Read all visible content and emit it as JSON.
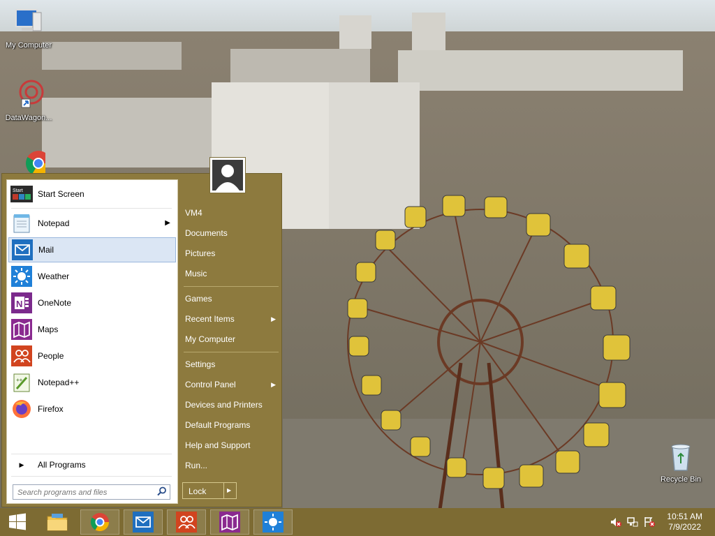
{
  "desktop": {
    "icons": [
      {
        "label": "My Computer",
        "icon": "computer-icon"
      },
      {
        "label": "DataWagon...",
        "icon": "datawagon-shortcut-icon"
      },
      {
        "label": "",
        "icon": "chrome-icon"
      },
      {
        "label": "Recycle Bin",
        "icon": "recycle-bin-icon"
      }
    ]
  },
  "start_menu": {
    "programs": [
      {
        "label": "Start Screen",
        "icon": "start-screen-icon",
        "has_submenu": false,
        "selected": false
      },
      {
        "label": "Notepad",
        "icon": "notepad-icon",
        "has_submenu": true,
        "selected": false
      },
      {
        "label": "Mail",
        "icon": "mail-icon",
        "has_submenu": false,
        "selected": true
      },
      {
        "label": "Weather",
        "icon": "weather-icon",
        "has_submenu": false,
        "selected": false
      },
      {
        "label": "OneNote",
        "icon": "onenote-icon",
        "has_submenu": false,
        "selected": false
      },
      {
        "label": "Maps",
        "icon": "maps-icon",
        "has_submenu": false,
        "selected": false
      },
      {
        "label": "People",
        "icon": "people-icon",
        "has_submenu": false,
        "selected": false
      },
      {
        "label": "Notepad++",
        "icon": "notepadpp-icon",
        "has_submenu": false,
        "selected": false
      },
      {
        "label": "Firefox",
        "icon": "firefox-icon",
        "has_submenu": false,
        "selected": false
      }
    ],
    "start_screen_tile_text": "Start",
    "all_programs": "All Programs",
    "search_placeholder": "Search programs and files",
    "places": [
      {
        "label": "VM4",
        "has_submenu": false
      },
      {
        "label": "Documents",
        "has_submenu": false
      },
      {
        "label": "Pictures",
        "has_submenu": false
      },
      {
        "label": "Music",
        "has_submenu": false
      },
      {
        "label": "Games",
        "has_submenu": false
      },
      {
        "label": "Recent Items",
        "has_submenu": true
      },
      {
        "label": "My Computer",
        "has_submenu": false
      },
      {
        "label": "Settings",
        "has_submenu": false
      },
      {
        "label": "Control Panel",
        "has_submenu": true
      },
      {
        "label": "Devices and Printers",
        "has_submenu": false
      },
      {
        "label": "Default Programs",
        "has_submenu": false
      },
      {
        "label": "Help and Support",
        "has_submenu": false
      },
      {
        "label": "Run...",
        "has_submenu": false
      }
    ],
    "lock_label": "Lock"
  },
  "taskbar": {
    "buttons": [
      "start-button",
      "file-explorer-icon",
      "chrome-icon",
      "mail-icon",
      "people-icon",
      "maps-icon",
      "weather-icon"
    ],
    "clock_time": "10:51 AM",
    "clock_date": "7/9/2022"
  },
  "colors": {
    "accent": "#8d7a3e",
    "taskbar": "#7d6b33",
    "selection": "#dbe6f4"
  }
}
